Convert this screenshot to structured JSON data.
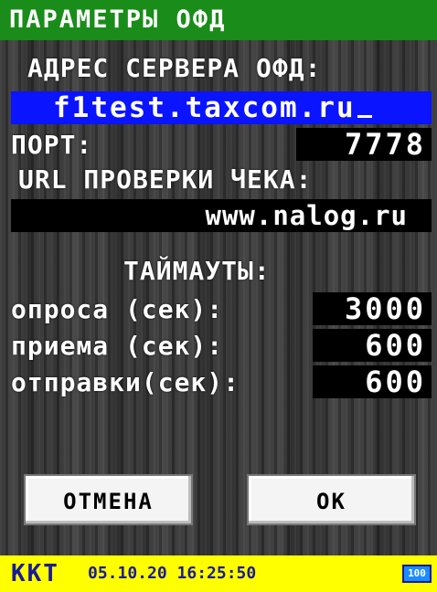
{
  "title": "ПАРАМЕТРЫ ОФД",
  "server": {
    "label": "АДРЕС СЕРВЕРА ОФД:",
    "value": "f1test.taxcom.ru"
  },
  "port": {
    "label": "ПОРТ:",
    "value": "7778"
  },
  "receipt_check": {
    "label": "URL ПРОВЕРКИ ЧЕКА:",
    "value": "www.nalog.ru"
  },
  "timeouts": {
    "heading": "ТАЙМАУТЫ:",
    "poll_label": "опроса (сек):",
    "poll_value": "3000",
    "receive_label": "приема (сек):",
    "receive_value": "600",
    "send_label": "отправки(сек):",
    "send_value": "600"
  },
  "buttons": {
    "cancel": "ОТМЕНА",
    "ok": "OK"
  },
  "status": {
    "device": "ККТ",
    "datetime": "05.10.20 16:25:50",
    "battery": "100",
    "battery_level": 1.0
  },
  "colors": {
    "title_bg": "#1a8c1a",
    "selected_field_bg": "#0a14ff",
    "status_bar_bg": "#ffff00"
  }
}
